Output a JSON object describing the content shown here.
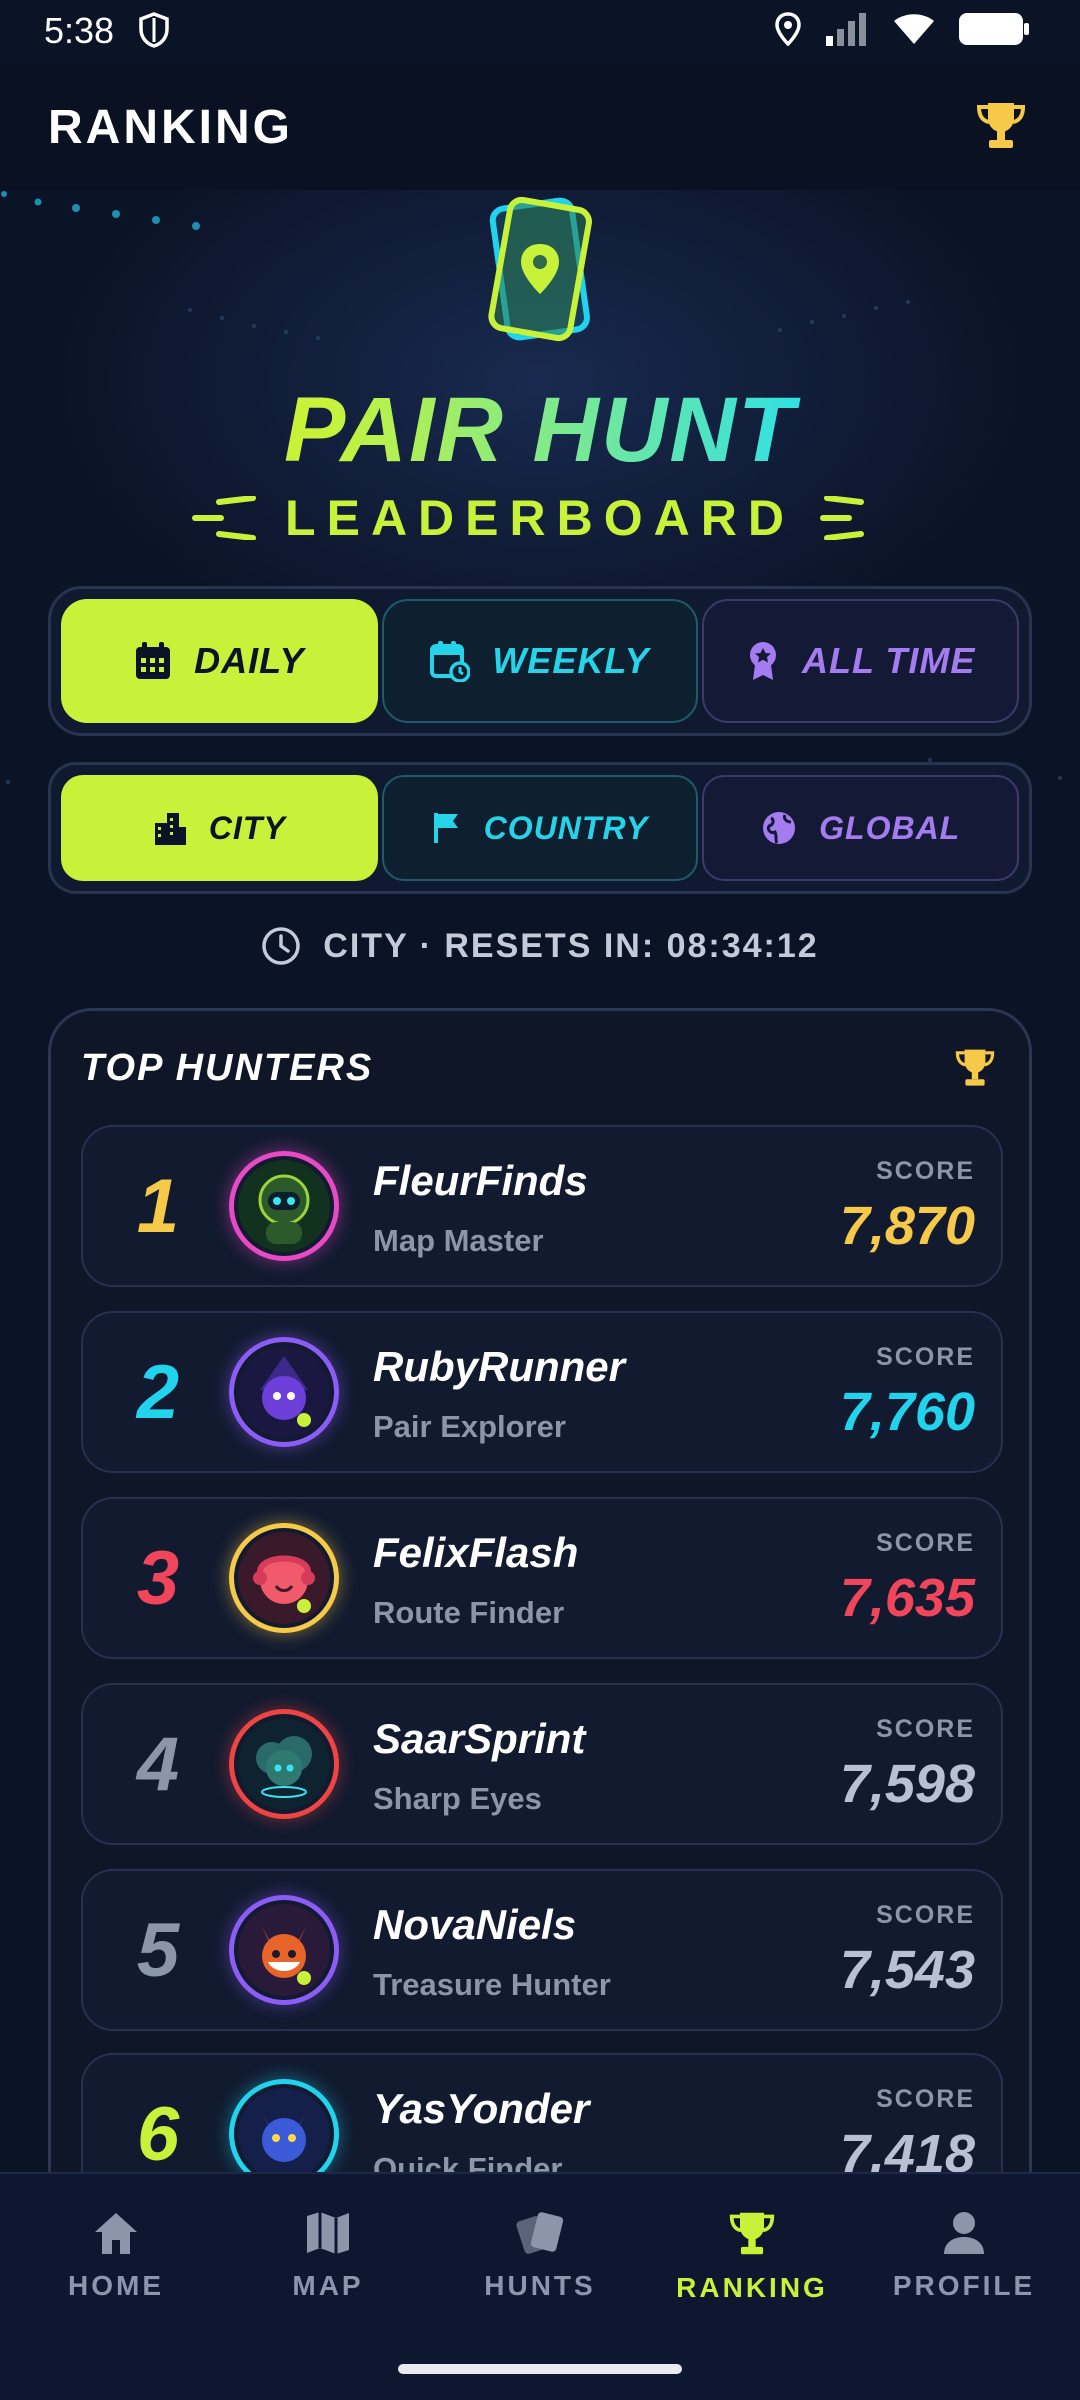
{
  "status_bar": {
    "time": "5:38"
  },
  "header": {
    "title": "RANKING"
  },
  "hero": {
    "title": "PAIR HUNT",
    "subtitle": "LEADERBOARD"
  },
  "period_tabs": [
    {
      "label": "DAILY",
      "icon": "calendar-icon",
      "active": true
    },
    {
      "label": "WEEKLY",
      "icon": "calendar-refresh-icon",
      "active": false
    },
    {
      "label": "ALL TIME",
      "icon": "award-icon",
      "active": false
    }
  ],
  "scope_tabs": [
    {
      "label": "CITY",
      "icon": "city-icon",
      "active": true
    },
    {
      "label": "COUNTRY",
      "icon": "flag-icon",
      "active": false
    },
    {
      "label": "GLOBAL",
      "icon": "globe-icon",
      "active": false
    }
  ],
  "reset": {
    "text": "CITY · RESETS IN: 08:34:12"
  },
  "leaderboard": {
    "title": "TOP HUNTERS",
    "score_label": "SCORE",
    "rows": [
      {
        "rank": "1",
        "name": "FleurFinds",
        "title": "Map Master",
        "score": "7,870",
        "color": "#f7c948",
        "ring": "#e84ac6"
      },
      {
        "rank": "2",
        "name": "RubyRunner",
        "title": "Pair Explorer",
        "score": "7,760",
        "color": "#22d3ee",
        "ring": "#8b5cf6"
      },
      {
        "rank": "3",
        "name": "FelixFlash",
        "title": "Route Finder",
        "score": "7,635",
        "color": "#f0455a",
        "ring": "#f7c948"
      },
      {
        "rank": "4",
        "name": "SaarSprint",
        "title": "Sharp Eyes",
        "score": "7,598",
        "color": "#b9c0d4",
        "ring": "#ef4444"
      },
      {
        "rank": "5",
        "name": "NovaNiels",
        "title": "Treasure Hunter",
        "score": "7,543",
        "color": "#b9c0d4",
        "ring": "#8b5cf6"
      },
      {
        "rank": "6",
        "name": "YasYonder",
        "title": "Quick Finder",
        "score": "7,418",
        "color": "#b9c0d4",
        "ring": "#22d3ee"
      }
    ]
  },
  "colors": {
    "accent": "#c8f23a",
    "cyan": "#22d3ee",
    "purple": "#a57cf0",
    "background": "#0b1326"
  },
  "nav": [
    {
      "label": "HOME",
      "icon": "home-icon"
    },
    {
      "label": "MAP",
      "icon": "map-icon"
    },
    {
      "label": "HUNTS",
      "icon": "cards-icon"
    },
    {
      "label": "RANKING",
      "icon": "trophy-icon",
      "active": true
    },
    {
      "label": "PROFILE",
      "icon": "person-icon"
    }
  ]
}
